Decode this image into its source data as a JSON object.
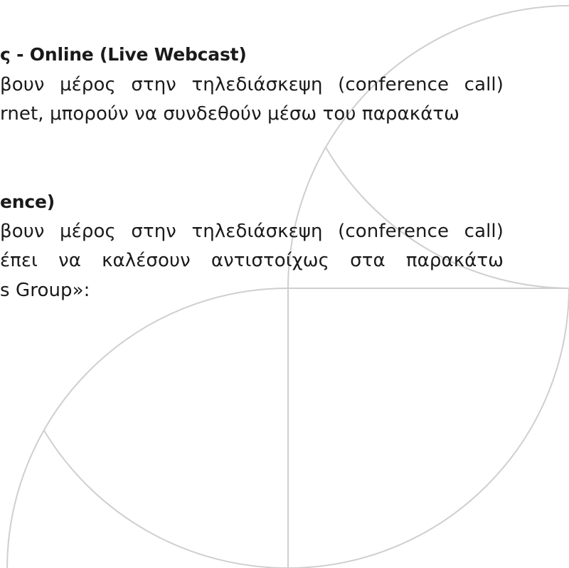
{
  "section_webcast": {
    "heading": "ς - Online (Live Webcast)",
    "line1": "βουν μέρος στην τηλεδιάσκεψη (conference call)",
    "line2": "rnet, μπορούν να συνδεθούν μέσω του παρακάτω"
  },
  "section_conference": {
    "heading": "ence)",
    "line1": "βουν μέρος στην τηλεδιάσκεψη (conference call)",
    "line2": "έπει να καλέσουν αντιστοίχως στα παρακάτω",
    "line3": "s Group»:"
  },
  "colors": {
    "decor_stroke": "#cfcfcf",
    "text": "#1a1a1a"
  }
}
